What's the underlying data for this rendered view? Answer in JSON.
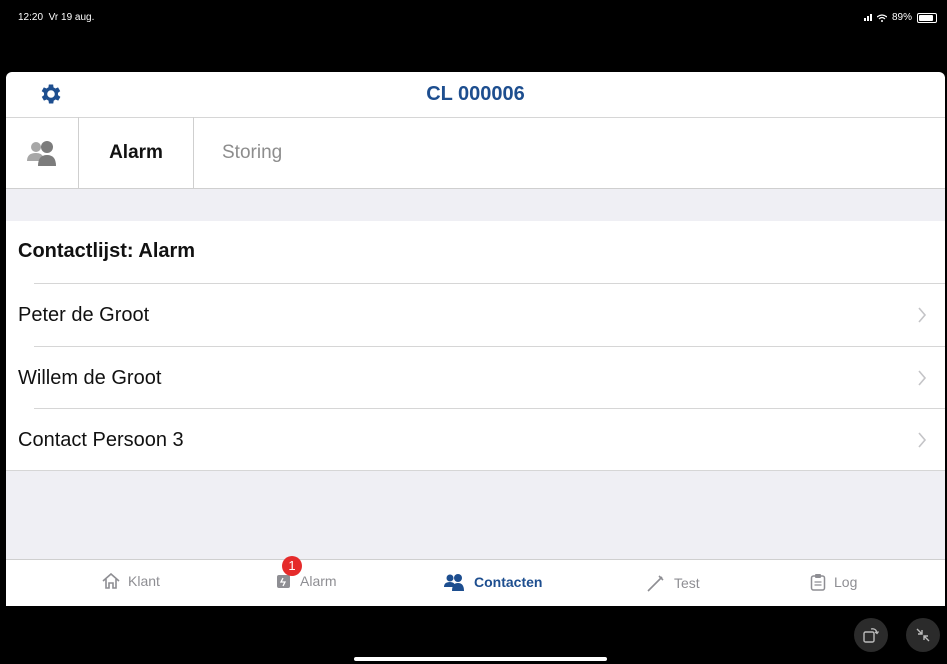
{
  "status_bar": {
    "time": "12:20",
    "date": "Vr 19 aug.",
    "battery": "89%"
  },
  "navbar": {
    "title": "CL 000006",
    "settings_icon": "gear-icon",
    "accent": "#1d4e8f"
  },
  "tabs": {
    "alarm": "Alarm",
    "storing": "Storing",
    "contacts_icon": "contacts-group-icon"
  },
  "list": {
    "title": "Contactlijst: Alarm",
    "items": [
      {
        "name": "Peter de Groot"
      },
      {
        "name": "Willem de Groot"
      },
      {
        "name": "Contact Persoon 3"
      }
    ]
  },
  "tabbar": {
    "klant": "Klant",
    "alarm": "Alarm",
    "alarm_badge": "1",
    "contacten": "Contacten",
    "test": "Test",
    "log": "Log",
    "badge_color": "#e52b2b"
  }
}
